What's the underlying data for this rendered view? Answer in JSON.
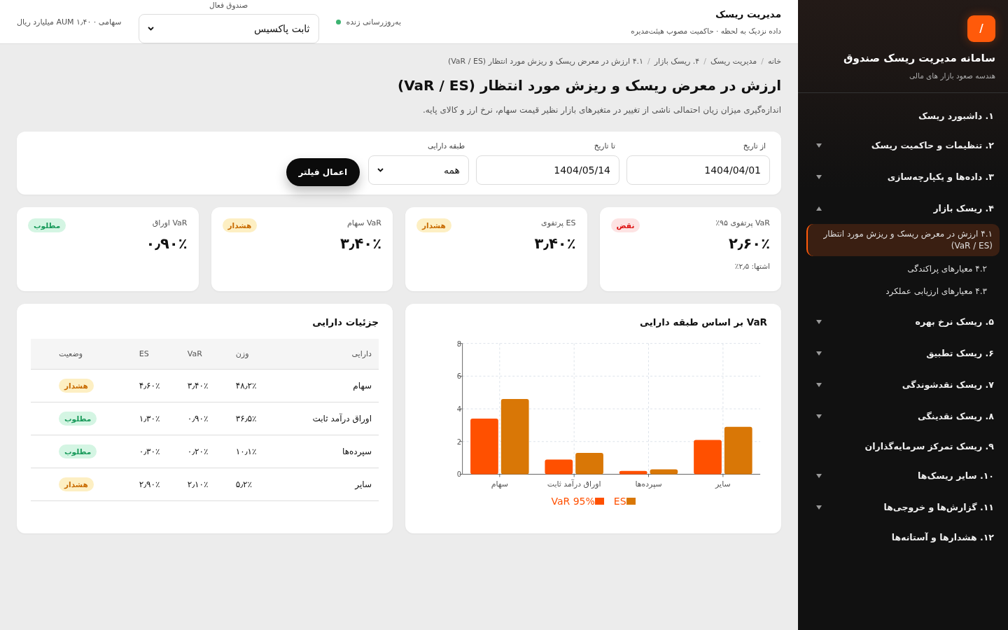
{
  "sidebar": {
    "logo_mark": "/",
    "title": "سامانه مدیریت ریسک صندوق",
    "subtitle": "هندسه صعود بازار های مالی",
    "items": [
      {
        "label": "۱. داشبورد ریسک",
        "kind": "link"
      },
      {
        "label": "۲. تنظیمات و حاکمیت ریسک",
        "kind": "group",
        "expanded": false
      },
      {
        "label": "۳. داده‌ها و یکپارچه‌سازی",
        "kind": "group",
        "expanded": false
      },
      {
        "label": "۴. ریسک بازار",
        "kind": "group",
        "expanded": true,
        "children": [
          {
            "label": "۴.۱ ارزش در معرض ریسک و ریزش مورد انتظار (VaR / ES)",
            "selected": true
          },
          {
            "label": "۴.۲ معیارهای پراکندگی",
            "selected": false
          },
          {
            "label": "۴.۳ معیارهای ارزیابی عملکرد",
            "selected": false
          }
        ]
      },
      {
        "label": "۵. ریسک نرخ بهره",
        "kind": "group",
        "expanded": false
      },
      {
        "label": "۶. ریسک تطبیق",
        "kind": "group",
        "expanded": false
      },
      {
        "label": "۷. ریسک نقدشوندگی",
        "kind": "group",
        "expanded": false
      },
      {
        "label": "۸. ریسک نقدینگی",
        "kind": "group",
        "expanded": false
      },
      {
        "label": "۹. ریسک تمرکز سرمایه‌گذاران",
        "kind": "link"
      },
      {
        "label": "۱۰. سایر ریسک‌ها",
        "kind": "group",
        "expanded": false
      },
      {
        "label": "۱۱. گزارش‌ها و خروجی‌ها",
        "kind": "group",
        "expanded": false
      },
      {
        "label": "۱۲. هشدارها و آستانه‌ها",
        "kind": "link"
      }
    ]
  },
  "topbar": {
    "title": "مدیریت ریسک",
    "subtitle": "داده نزدیک به لحظه · حاکمیت مصوب هیئت‌مدیره",
    "live_label": "به‌روزرسانی زنده",
    "fund_label": "صندوق فعال",
    "fund_value": "ثابت پاکسیس",
    "fund_info": "سهامی · AUM ۱٫۴۰ میلیارد ریال"
  },
  "breadcrumb": {
    "separator": "/",
    "items": [
      "خانه",
      "مدیریت ریسک",
      "۴. ریسک بازار",
      "۴.۱ ارزش در معرض ریسک و ریزش مورد انتظار (VaR / ES)"
    ]
  },
  "page": {
    "title": "ارزش در معرض ریسک و ریزش مورد انتظار (VaR / ES)",
    "description": "اندازه‌گیری میزان زیان احتمالی ناشی از تغییر در متغیرهای بازار نظیر قیمت سهام، نرخ ارز و کالای پایه."
  },
  "filters": {
    "from_label": "از تاریخ",
    "from_value": "1404/04/01",
    "to_label": "تا تاریخ",
    "to_value": "1404/05/14",
    "class_label": "طبقه دارایی",
    "class_value": "همه",
    "apply": "اعمال فیلتر"
  },
  "kpis": [
    {
      "label": "VaR پرتفوی ۹۵٪",
      "value": "۲٫۶۰٪",
      "badge": "نقض",
      "kind": "breach",
      "note": "اشتها: ۲٫۵٪"
    },
    {
      "label": "ES پرتفوی",
      "value": "۳٫۴۰٪",
      "badge": "هشدار",
      "kind": "warning"
    },
    {
      "label": "VaR سهام",
      "value": "۳٫۴۰٪",
      "badge": "هشدار",
      "kind": "warning"
    },
    {
      "label": "VaR اوراق",
      "value": "۰٫۹۰٪",
      "badge": "مطلوب",
      "kind": "ok"
    }
  ],
  "chart_card": {
    "title": "VaR بر اساس طبقه دارایی",
    "chart_data": {
      "type": "bar",
      "grid": true,
      "legend": "bottom",
      "categories": [
        "سهام",
        "اوراق درآمد ثابت",
        "سپرده‌ها",
        "سایر"
      ],
      "ylim": [
        0,
        8
      ],
      "yticks": [
        0,
        2,
        4,
        6,
        8
      ],
      "series": [
        {
          "name": "VaR 95%",
          "color": "#ff5000",
          "values": [
            3.4,
            0.9,
            0.2,
            2.1
          ]
        },
        {
          "name": "ES",
          "color": "#d97706",
          "values": [
            4.6,
            1.3,
            0.3,
            2.9
          ]
        }
      ]
    }
  },
  "table_card": {
    "title": "جزئیات دارایی",
    "columns": [
      "دارایی",
      "وزن",
      "VaR",
      "ES",
      "وضعیت"
    ],
    "rows": [
      {
        "asset": "سهام",
        "weight": "۴۸٫۲٪",
        "var": "۳٫۴۰٪",
        "es": "۴٫۶۰٪",
        "status_text": "هشدار",
        "kind": "warning"
      },
      {
        "asset": "اوراق درآمد ثابت",
        "weight": "۳۶٫۵٪",
        "var": "۰٫۹۰٪",
        "es": "۱٫۳۰٪",
        "status_text": "مطلوب",
        "kind": "ok"
      },
      {
        "asset": "سپرده‌ها",
        "weight": "۱۰٫۱٪",
        "var": "۰٫۲۰٪",
        "es": "۰٫۳۰٪",
        "status_text": "مطلوب",
        "kind": "ok"
      },
      {
        "asset": "سایر",
        "weight": "۵٫۲٪",
        "var": "۲٫۱۰٪",
        "es": "۲٫۹۰٪",
        "status_text": "هشدار",
        "kind": "warning"
      }
    ]
  }
}
